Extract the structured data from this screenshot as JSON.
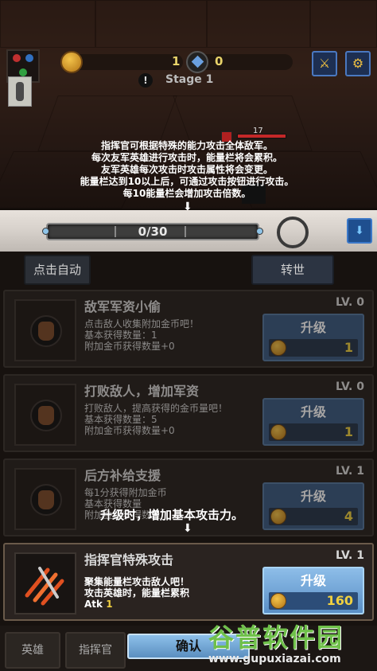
{
  "hud": {
    "gold_amount": "1",
    "gem_amount": "0",
    "stage_label": "Stage 1",
    "enemy_level": "17"
  },
  "tutorial_top": [
    "指挥官可根据特殊的能力攻击全体敌军。",
    "每次友军英雄进行攻击时，能量栏将会累积。",
    "友军英雄每次攻击时攻击属性将会变更。",
    "能量栏达到10以上后，可通过攻击按钮进行攻击。",
    "每10能量栏会增加攻击倍数。"
  ],
  "energy": {
    "text": "0/30",
    "fill": 0
  },
  "panel_tabs": {
    "auto_click": "点击自动",
    "rebirth": "转世"
  },
  "upgrades": [
    {
      "title": "敌军军资小偷",
      "level": "LV. 0",
      "desc": [
        "点击敌人收集附加金币吧！",
        "基本获得数量：1",
        "附加金币获得数量+0"
      ],
      "button": "升级",
      "cost": "1"
    },
    {
      "title": "打败敌人，增加军资",
      "level": "LV. 0",
      "desc": [
        "打败敌人，提高获得的金币量吧！",
        "基本获得数量：5",
        "附加金币获得数量+0"
      ],
      "button": "升级",
      "cost": "1"
    },
    {
      "title": "后方补给支援",
      "level": "LV. 1",
      "desc": [
        "每1分获得附加金币",
        "基本获得数量",
        "附加金币获得数量"
      ],
      "button": "升级",
      "cost": "4"
    },
    {
      "title": "指挥官特殊攻击",
      "level": "LV. 1",
      "desc": [
        "聚集能量栏攻击敌人吧！",
        "攻击英雄时，能量栏累积"
      ],
      "atk_label": "Atk",
      "atk_value": "1",
      "button": "升级",
      "cost": "160"
    }
  ],
  "tutorial_mid": "升级时，增加基本攻击力。",
  "bottom_nav": {
    "heroes": "英雄",
    "commander": "指挥官",
    "confirm": "确认"
  },
  "watermark": {
    "brand": "谷普软件园",
    "url": "www.gupuxiazai.com"
  },
  "colors": {
    "accent_blue": "#5a8fc6",
    "gold": "#f0d040",
    "watermark_green": "#6fc04a"
  }
}
